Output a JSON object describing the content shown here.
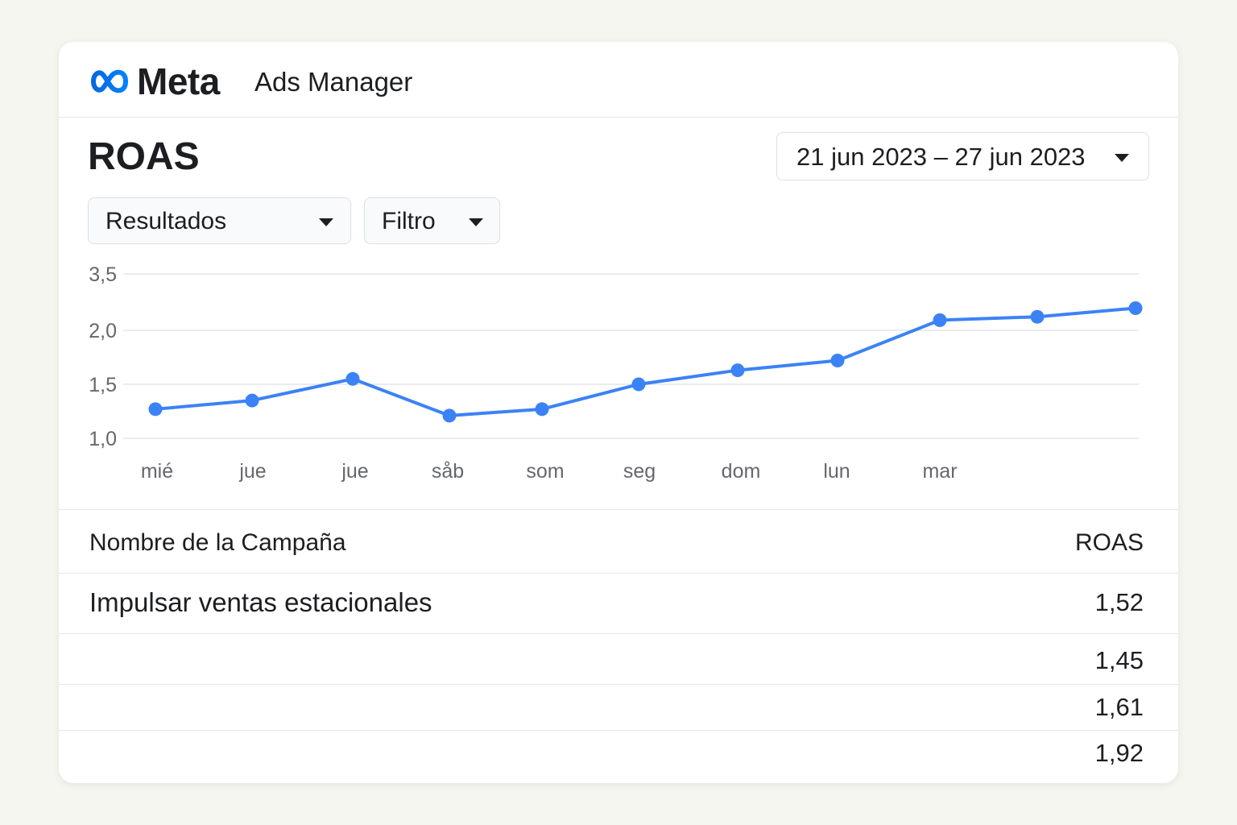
{
  "header": {
    "logo_text": "Meta",
    "app_name": "Ads Manager"
  },
  "page": {
    "title": "ROAS",
    "date_range": "21 jun 2023 – 27 jun 2023",
    "results_dropdown": "Resultados",
    "filter_dropdown": "Filtro"
  },
  "colors": {
    "accent": "#3b82f6",
    "text": "#1c1e21",
    "muted": "#65676b",
    "grid": "#e4e6ea"
  },
  "chart_data": {
    "type": "line",
    "y_tick_labels": [
      "3,5",
      "2,0",
      "1,5",
      "1,0"
    ],
    "x_tick_labels": [
      "mié",
      "jue",
      "jue",
      "såb",
      "som",
      "seg",
      "dom",
      "lun",
      "mar"
    ],
    "values": [
      1.27,
      1.35,
      1.55,
      1.21,
      1.27,
      1.5,
      1.63,
      1.72,
      2.27,
      2.36,
      2.59
    ],
    "grid": true,
    "legend": "none"
  },
  "table": {
    "headers": [
      "Nombre de la Campaña",
      "ROAS"
    ],
    "rows": [
      {
        "name": "Impulsar ventas estacionales",
        "roas": "1,52"
      },
      {
        "name": "",
        "roas": "1,45"
      },
      {
        "name": "",
        "roas": "1,61"
      },
      {
        "name": "",
        "roas": "1,92"
      }
    ]
  }
}
